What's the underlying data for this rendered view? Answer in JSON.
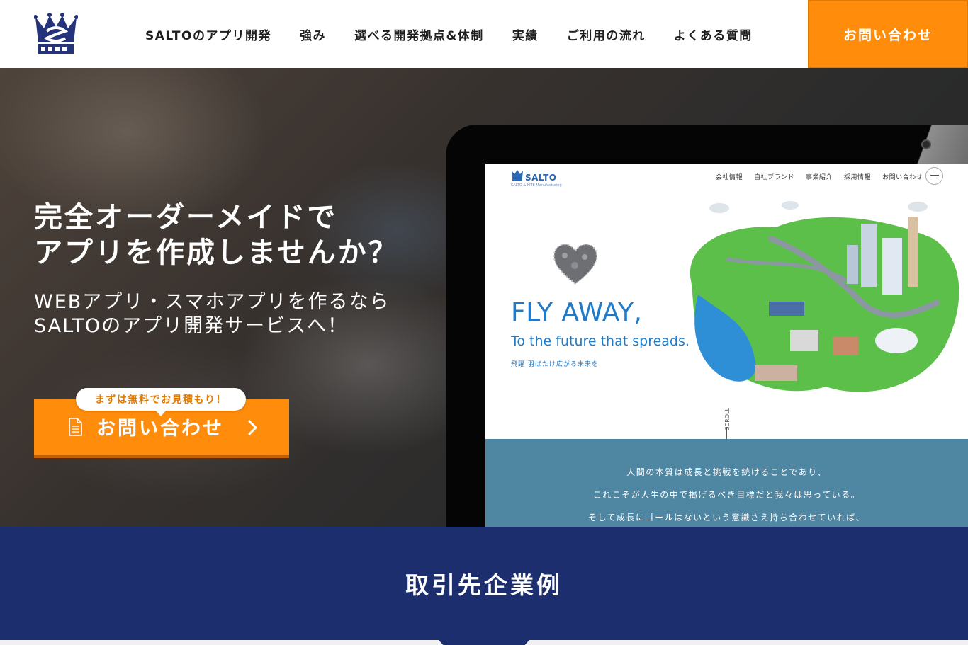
{
  "header": {
    "logo_icon": "crown-s-logo-icon",
    "nav": [
      {
        "label": "SALTOのアプリ開発"
      },
      {
        "label": "強み"
      },
      {
        "label": "選べる開発拠点&体制"
      },
      {
        "label": "実績"
      },
      {
        "label": "ご利用の流れ"
      },
      {
        "label": "よくある質問"
      }
    ],
    "cta_label": "お問い合わせ"
  },
  "hero": {
    "title": "完全オーダーメイドで\nアプリを作成しませんか？",
    "subtitle": "WEBアプリ・スマホアプリを作るなら\nSALTOのアプリ開発サービスへ！",
    "cta_bubble": "まずは無料でお見積もり！",
    "cta_label": "お問い合わせ",
    "cta_icon": "document-icon",
    "cta_arrow_icon": "chevron-right-icon"
  },
  "mockup": {
    "logo_text": "SALTO",
    "logo_tag": "SALTO & KITE Manufacturing",
    "nav": [
      "会社情報",
      "自社ブランド",
      "事業紹介",
      "採用情報",
      "お問い合わせ"
    ],
    "fly_title": "FLY AWAY,",
    "fly_subtitle": "To the future that spreads.",
    "fly_jp": "飛躍 羽ばたけ広がる未来を",
    "scroll_label": "SCROLL",
    "band_lines": [
      "人間の本質は成長と挑戦を続けることであり、",
      "これこそが人生の中で掲げるべき目標だと我々は思っている。",
      "そして成長にゴールはないという意識さえ持ち合わせていれば、"
    ]
  },
  "clients": {
    "title": "取引先企業例"
  },
  "colors": {
    "accent": "#ff8c0a",
    "navy": "#1c2e6e",
    "mockup_blue": "#1f7bc9",
    "mockup_band": "#4f86a2"
  }
}
